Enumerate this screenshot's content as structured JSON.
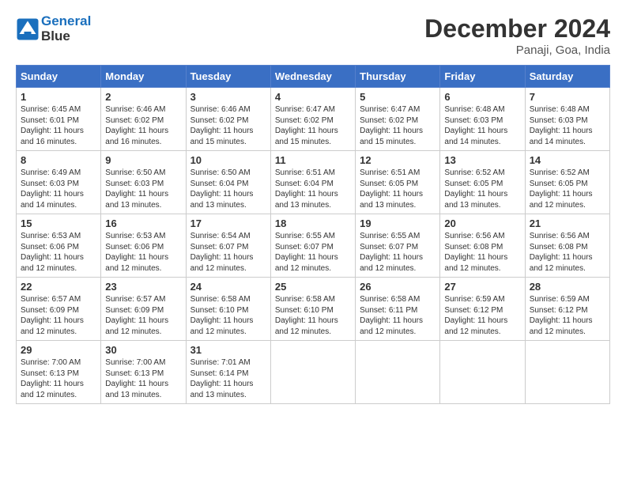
{
  "header": {
    "logo_line1": "General",
    "logo_line2": "Blue",
    "month": "December 2024",
    "location": "Panaji, Goa, India"
  },
  "days_of_week": [
    "Sunday",
    "Monday",
    "Tuesday",
    "Wednesday",
    "Thursday",
    "Friday",
    "Saturday"
  ],
  "weeks": [
    [
      {
        "day": "1",
        "sunrise": "6:45 AM",
        "sunset": "6:01 PM",
        "daylight": "11 hours and 16 minutes."
      },
      {
        "day": "2",
        "sunrise": "6:46 AM",
        "sunset": "6:02 PM",
        "daylight": "11 hours and 16 minutes."
      },
      {
        "day": "3",
        "sunrise": "6:46 AM",
        "sunset": "6:02 PM",
        "daylight": "11 hours and 15 minutes."
      },
      {
        "day": "4",
        "sunrise": "6:47 AM",
        "sunset": "6:02 PM",
        "daylight": "11 hours and 15 minutes."
      },
      {
        "day": "5",
        "sunrise": "6:47 AM",
        "sunset": "6:02 PM",
        "daylight": "11 hours and 15 minutes."
      },
      {
        "day": "6",
        "sunrise": "6:48 AM",
        "sunset": "6:03 PM",
        "daylight": "11 hours and 14 minutes."
      },
      {
        "day": "7",
        "sunrise": "6:48 AM",
        "sunset": "6:03 PM",
        "daylight": "11 hours and 14 minutes."
      }
    ],
    [
      {
        "day": "8",
        "sunrise": "6:49 AM",
        "sunset": "6:03 PM",
        "daylight": "11 hours and 14 minutes."
      },
      {
        "day": "9",
        "sunrise": "6:50 AM",
        "sunset": "6:03 PM",
        "daylight": "11 hours and 13 minutes."
      },
      {
        "day": "10",
        "sunrise": "6:50 AM",
        "sunset": "6:04 PM",
        "daylight": "11 hours and 13 minutes."
      },
      {
        "day": "11",
        "sunrise": "6:51 AM",
        "sunset": "6:04 PM",
        "daylight": "11 hours and 13 minutes."
      },
      {
        "day": "12",
        "sunrise": "6:51 AM",
        "sunset": "6:05 PM",
        "daylight": "11 hours and 13 minutes."
      },
      {
        "day": "13",
        "sunrise": "6:52 AM",
        "sunset": "6:05 PM",
        "daylight": "11 hours and 13 minutes."
      },
      {
        "day": "14",
        "sunrise": "6:52 AM",
        "sunset": "6:05 PM",
        "daylight": "11 hours and 12 minutes."
      }
    ],
    [
      {
        "day": "15",
        "sunrise": "6:53 AM",
        "sunset": "6:06 PM",
        "daylight": "11 hours and 12 minutes."
      },
      {
        "day": "16",
        "sunrise": "6:53 AM",
        "sunset": "6:06 PM",
        "daylight": "11 hours and 12 minutes."
      },
      {
        "day": "17",
        "sunrise": "6:54 AM",
        "sunset": "6:07 PM",
        "daylight": "11 hours and 12 minutes."
      },
      {
        "day": "18",
        "sunrise": "6:55 AM",
        "sunset": "6:07 PM",
        "daylight": "11 hours and 12 minutes."
      },
      {
        "day": "19",
        "sunrise": "6:55 AM",
        "sunset": "6:07 PM",
        "daylight": "11 hours and 12 minutes."
      },
      {
        "day": "20",
        "sunrise": "6:56 AM",
        "sunset": "6:08 PM",
        "daylight": "11 hours and 12 minutes."
      },
      {
        "day": "21",
        "sunrise": "6:56 AM",
        "sunset": "6:08 PM",
        "daylight": "11 hours and 12 minutes."
      }
    ],
    [
      {
        "day": "22",
        "sunrise": "6:57 AM",
        "sunset": "6:09 PM",
        "daylight": "11 hours and 12 minutes."
      },
      {
        "day": "23",
        "sunrise": "6:57 AM",
        "sunset": "6:09 PM",
        "daylight": "11 hours and 12 minutes."
      },
      {
        "day": "24",
        "sunrise": "6:58 AM",
        "sunset": "6:10 PM",
        "daylight": "11 hours and 12 minutes."
      },
      {
        "day": "25",
        "sunrise": "6:58 AM",
        "sunset": "6:10 PM",
        "daylight": "11 hours and 12 minutes."
      },
      {
        "day": "26",
        "sunrise": "6:58 AM",
        "sunset": "6:11 PM",
        "daylight": "11 hours and 12 minutes."
      },
      {
        "day": "27",
        "sunrise": "6:59 AM",
        "sunset": "6:12 PM",
        "daylight": "11 hours and 12 minutes."
      },
      {
        "day": "28",
        "sunrise": "6:59 AM",
        "sunset": "6:12 PM",
        "daylight": "11 hours and 12 minutes."
      }
    ],
    [
      {
        "day": "29",
        "sunrise": "7:00 AM",
        "sunset": "6:13 PM",
        "daylight": "11 hours and 12 minutes."
      },
      {
        "day": "30",
        "sunrise": "7:00 AM",
        "sunset": "6:13 PM",
        "daylight": "11 hours and 13 minutes."
      },
      {
        "day": "31",
        "sunrise": "7:01 AM",
        "sunset": "6:14 PM",
        "daylight": "11 hours and 13 minutes."
      },
      null,
      null,
      null,
      null
    ]
  ]
}
